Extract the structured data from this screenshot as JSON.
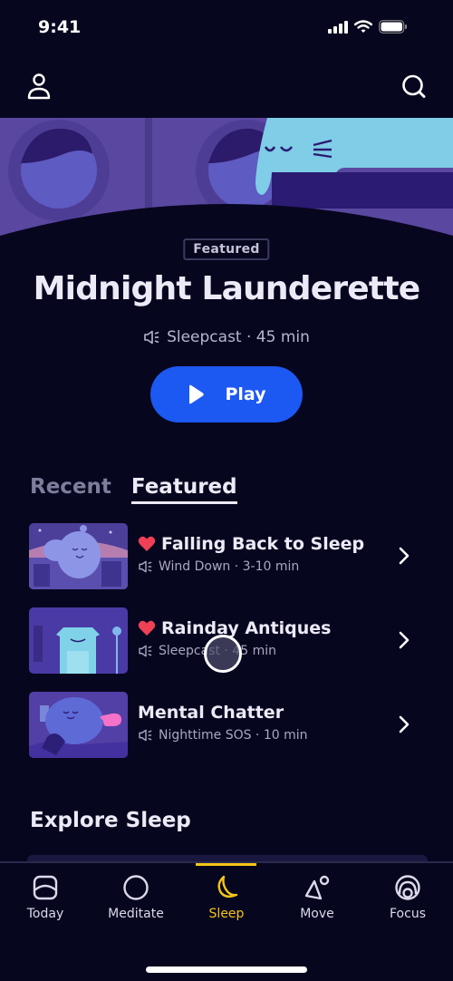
{
  "status_bar": {
    "time": "9:41"
  },
  "header": {
    "profile_icon": "person-icon",
    "search_icon": "search-icon"
  },
  "featured": {
    "badge": "Featured",
    "title": "Midnight Launderette",
    "meta": "Sleepcast · 45 min",
    "meta_icon": "speaker-icon",
    "play_label": "Play"
  },
  "tabs": [
    {
      "label": "Recent",
      "active": false
    },
    {
      "label": "Featured",
      "active": true
    }
  ],
  "list": [
    {
      "title": "Falling Back to Sleep",
      "meta": "Wind Down · 3-10 min",
      "favorite": true
    },
    {
      "title": "Rainday Antiques",
      "meta": "Sleepcast · 45 min",
      "favorite": true
    },
    {
      "title": "Mental Chatter",
      "meta": "Nighttime SOS · 10 min",
      "favorite": false
    }
  ],
  "explore": {
    "title": "Explore Sleep"
  },
  "tabbar": [
    {
      "label": "Today",
      "icon": "today-icon"
    },
    {
      "label": "Meditate",
      "icon": "circle-icon"
    },
    {
      "label": "Sleep",
      "icon": "moon-icon",
      "active": true
    },
    {
      "label": "Move",
      "icon": "move-icon"
    },
    {
      "label": "Focus",
      "icon": "focus-icon"
    }
  ],
  "colors": {
    "background": "#07061f",
    "accent_blue": "#1c58f2",
    "active_yellow": "#f5c518",
    "heart": "#ef4056"
  }
}
